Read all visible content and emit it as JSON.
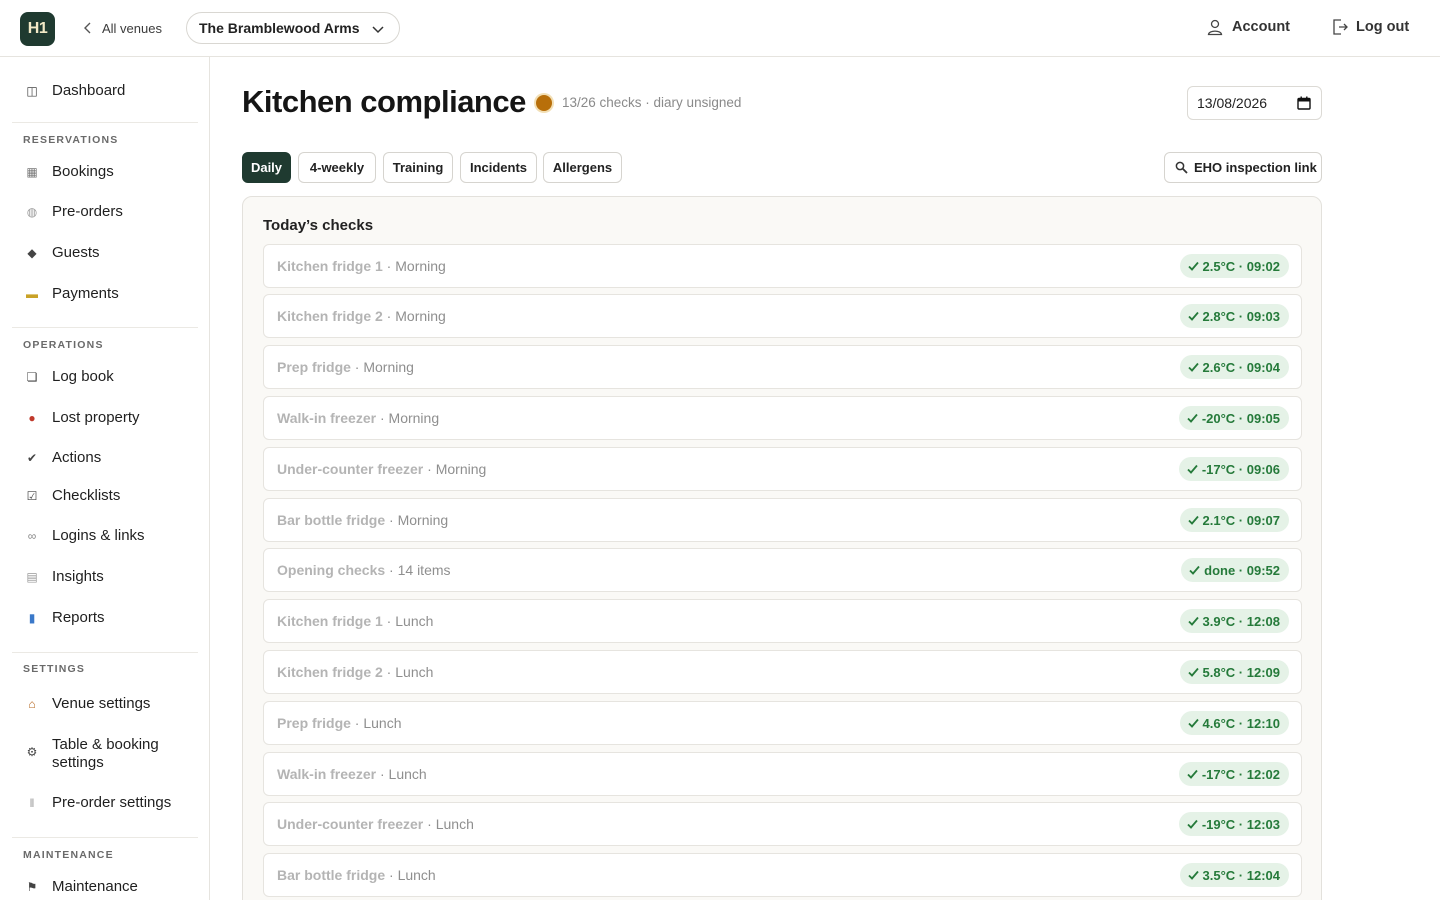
{
  "topbar": {
    "logo_text": "H1",
    "back_label": "All venues",
    "venue_name": "The Bramblewood Arms",
    "account_label": "Account",
    "logout_label": "Log out"
  },
  "sidebar": {
    "dashboard": {
      "icon": "dashboard-icon",
      "label": "Dashboard"
    },
    "sections": [
      {
        "title": "RESERVATIONS",
        "items": [
          {
            "icon": "bookings-icon",
            "label": "Bookings"
          },
          {
            "icon": "plate-icon",
            "label": "Pre-orders"
          },
          {
            "icon": "diamond-icon",
            "label": "Guests"
          },
          {
            "icon": "card-icon",
            "label": "Payments"
          }
        ]
      },
      {
        "title": "OPERATIONS",
        "items": [
          {
            "icon": "logbook-icon",
            "label": "Log book"
          },
          {
            "icon": "bag-icon",
            "label": "Lost property"
          },
          {
            "icon": "check-icon",
            "label": "Actions"
          },
          {
            "icon": "checkbox-icon",
            "label": "Checklists"
          },
          {
            "icon": "link-icon",
            "label": "Logins & links"
          },
          {
            "icon": "insights-icon",
            "label": "Insights"
          },
          {
            "icon": "chart-icon",
            "label": "Reports"
          }
        ]
      },
      {
        "title": "SETTINGS",
        "items": [
          {
            "icon": "house-icon",
            "label": "Venue settings"
          },
          {
            "icon": "gear-icon",
            "label": "Table & booking settings"
          },
          {
            "icon": "cutlery-icon",
            "label": "Pre-order settings"
          }
        ]
      },
      {
        "title": "MAINTENANCE",
        "items": [
          {
            "icon": "flag-icon",
            "label": "Maintenance"
          }
        ]
      }
    ]
  },
  "main": {
    "title": "Kitchen compliance",
    "status_color": "#b86f0a",
    "status_text": "13/26 checks · diary unsigned",
    "date_value": "13/08/2026",
    "tabs": [
      "Daily",
      "4-weekly",
      "Training",
      "Incidents",
      "Allergens"
    ],
    "active_tab": "Daily",
    "eho_label": "EHO inspection link",
    "panel_title": "Today’s checks",
    "checks": [
      {
        "name": "Kitchen fridge 1",
        "session": "Morning",
        "result": "2.5°C · 09:02"
      },
      {
        "name": "Kitchen fridge 2",
        "session": "Morning",
        "result": "2.8°C · 09:03"
      },
      {
        "name": "Prep fridge",
        "session": "Morning",
        "result": "2.6°C · 09:04"
      },
      {
        "name": "Walk-in freezer",
        "session": "Morning",
        "result": "-20°C · 09:05"
      },
      {
        "name": "Under-counter freezer",
        "session": "Morning",
        "result": "-17°C · 09:06"
      },
      {
        "name": "Bar bottle fridge",
        "session": "Morning",
        "result": "2.1°C · 09:07"
      },
      {
        "name": "Opening checks",
        "session": "14 items",
        "result": "done · 09:52"
      },
      {
        "name": "Kitchen fridge 1",
        "session": "Lunch",
        "result": "3.9°C · 12:08"
      },
      {
        "name": "Kitchen fridge 2",
        "session": "Lunch",
        "result": "5.8°C · 12:09"
      },
      {
        "name": "Prep fridge",
        "session": "Lunch",
        "result": "4.6°C · 12:10"
      },
      {
        "name": "Walk-in freezer",
        "session": "Lunch",
        "result": "-17°C · 12:02"
      },
      {
        "name": "Under-counter freezer",
        "session": "Lunch",
        "result": "-19°C · 12:03"
      },
      {
        "name": "Bar bottle fridge",
        "session": "Lunch",
        "result": "3.5°C · 12:04"
      }
    ]
  }
}
